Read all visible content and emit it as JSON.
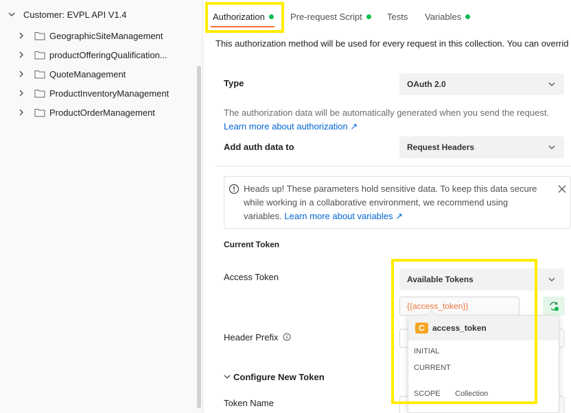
{
  "sidebar": {
    "collection": "Customer: EVPL API V1.4",
    "folders": [
      {
        "label": "GeographicSiteManagement"
      },
      {
        "label": "productOfferingQualification..."
      },
      {
        "label": "QuoteManagement"
      },
      {
        "label": "ProductInventoryManagement"
      },
      {
        "label": "ProductOrderManagement"
      }
    ]
  },
  "tabs": [
    {
      "label": "Authorization",
      "dot": true
    },
    {
      "label": "Pre-request Script",
      "dot": true
    },
    {
      "label": "Tests",
      "dot": false
    },
    {
      "label": "Variables",
      "dot": true
    }
  ],
  "auth": {
    "description": "This authorization method will be used for every request in this collection. You can overrid",
    "type_label": "Type",
    "type_value": "OAuth 2.0",
    "auto_note": "The authorization data will be automatically generated when you send the request.",
    "learn_link": "Learn more about authorization ↗",
    "add_auth_label": "Add auth data to",
    "add_auth_value": "Request Headers",
    "alert_text": "Heads up! These parameters hold sensitive data. To keep this data secure while working in a collaborative environment, we recommend using variables.",
    "alert_link": "Learn more about variables ↗",
    "current_token": "Current Token",
    "access_token_label": "Access Token",
    "available_tokens": "Available Tokens",
    "access_token_value": "{{access_token}}",
    "header_prefix": "Header Prefix",
    "configure_new_token": "Configure New Token",
    "token_name": "Token Name"
  },
  "popover": {
    "badge": "C",
    "name": "access_token",
    "initial_label": "INITIAL",
    "current_label": "CURRENT",
    "scope_label": "SCOPE",
    "scope_value": "Collection"
  },
  "colors": {
    "accent": "#ff6c37",
    "dot_green": "#0cbb52",
    "link": "#0265d2",
    "highlight": "#ffec00",
    "badge_orange": "#f5a623"
  }
}
